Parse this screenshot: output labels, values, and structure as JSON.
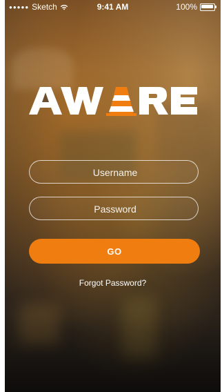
{
  "status_bar": {
    "carrier": "Sketch",
    "time": "9:41 AM",
    "battery_percent": "100%",
    "icons": [
      "signal-dots-icon",
      "wifi-icon",
      "battery-icon"
    ]
  },
  "logo": {
    "text": "AWARE",
    "icon": "traffic-cone-icon",
    "colors": {
      "letters": "#ffffff",
      "cone": "#f07d10"
    }
  },
  "login_form": {
    "username_placeholder": "Username",
    "password_placeholder": "Password",
    "submit_label": "GO",
    "forgot_link": "Forgot Password?"
  },
  "colors": {
    "accent": "#f07d10",
    "text": "#ffffff"
  }
}
